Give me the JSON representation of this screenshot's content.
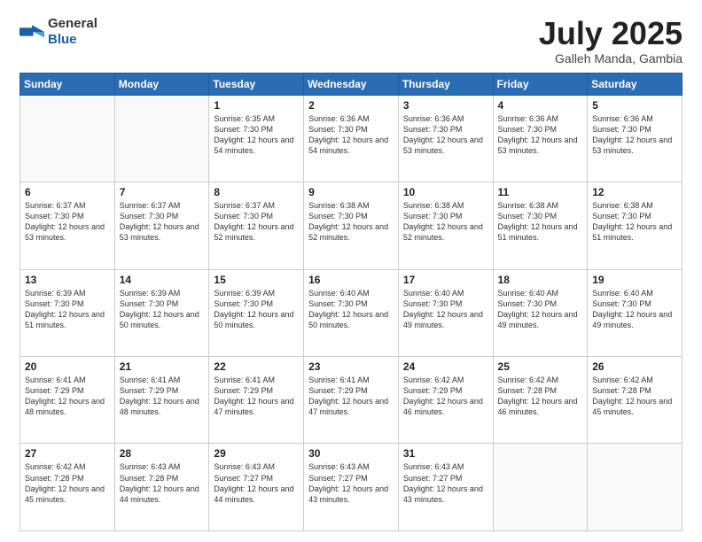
{
  "logo": {
    "text_general": "General",
    "text_blue": "Blue"
  },
  "title": {
    "month_year": "July 2025",
    "location": "Galleh Manda, Gambia"
  },
  "weekdays": [
    "Sunday",
    "Monday",
    "Tuesday",
    "Wednesday",
    "Thursday",
    "Friday",
    "Saturday"
  ],
  "weeks": [
    [
      {
        "day": "",
        "info": ""
      },
      {
        "day": "",
        "info": ""
      },
      {
        "day": "1",
        "info": "Sunrise: 6:35 AM\nSunset: 7:30 PM\nDaylight: 12 hours and 54 minutes."
      },
      {
        "day": "2",
        "info": "Sunrise: 6:36 AM\nSunset: 7:30 PM\nDaylight: 12 hours and 54 minutes."
      },
      {
        "day": "3",
        "info": "Sunrise: 6:36 AM\nSunset: 7:30 PM\nDaylight: 12 hours and 53 minutes."
      },
      {
        "day": "4",
        "info": "Sunrise: 6:36 AM\nSunset: 7:30 PM\nDaylight: 12 hours and 53 minutes."
      },
      {
        "day": "5",
        "info": "Sunrise: 6:36 AM\nSunset: 7:30 PM\nDaylight: 12 hours and 53 minutes."
      }
    ],
    [
      {
        "day": "6",
        "info": "Sunrise: 6:37 AM\nSunset: 7:30 PM\nDaylight: 12 hours and 53 minutes."
      },
      {
        "day": "7",
        "info": "Sunrise: 6:37 AM\nSunset: 7:30 PM\nDaylight: 12 hours and 53 minutes."
      },
      {
        "day": "8",
        "info": "Sunrise: 6:37 AM\nSunset: 7:30 PM\nDaylight: 12 hours and 52 minutes."
      },
      {
        "day": "9",
        "info": "Sunrise: 6:38 AM\nSunset: 7:30 PM\nDaylight: 12 hours and 52 minutes."
      },
      {
        "day": "10",
        "info": "Sunrise: 6:38 AM\nSunset: 7:30 PM\nDaylight: 12 hours and 52 minutes."
      },
      {
        "day": "11",
        "info": "Sunrise: 6:38 AM\nSunset: 7:30 PM\nDaylight: 12 hours and 51 minutes."
      },
      {
        "day": "12",
        "info": "Sunrise: 6:38 AM\nSunset: 7:30 PM\nDaylight: 12 hours and 51 minutes."
      }
    ],
    [
      {
        "day": "13",
        "info": "Sunrise: 6:39 AM\nSunset: 7:30 PM\nDaylight: 12 hours and 51 minutes."
      },
      {
        "day": "14",
        "info": "Sunrise: 6:39 AM\nSunset: 7:30 PM\nDaylight: 12 hours and 50 minutes."
      },
      {
        "day": "15",
        "info": "Sunrise: 6:39 AM\nSunset: 7:30 PM\nDaylight: 12 hours and 50 minutes."
      },
      {
        "day": "16",
        "info": "Sunrise: 6:40 AM\nSunset: 7:30 PM\nDaylight: 12 hours and 50 minutes."
      },
      {
        "day": "17",
        "info": "Sunrise: 6:40 AM\nSunset: 7:30 PM\nDaylight: 12 hours and 49 minutes."
      },
      {
        "day": "18",
        "info": "Sunrise: 6:40 AM\nSunset: 7:30 PM\nDaylight: 12 hours and 49 minutes."
      },
      {
        "day": "19",
        "info": "Sunrise: 6:40 AM\nSunset: 7:30 PM\nDaylight: 12 hours and 49 minutes."
      }
    ],
    [
      {
        "day": "20",
        "info": "Sunrise: 6:41 AM\nSunset: 7:29 PM\nDaylight: 12 hours and 48 minutes."
      },
      {
        "day": "21",
        "info": "Sunrise: 6:41 AM\nSunset: 7:29 PM\nDaylight: 12 hours and 48 minutes."
      },
      {
        "day": "22",
        "info": "Sunrise: 6:41 AM\nSunset: 7:29 PM\nDaylight: 12 hours and 47 minutes."
      },
      {
        "day": "23",
        "info": "Sunrise: 6:41 AM\nSunset: 7:29 PM\nDaylight: 12 hours and 47 minutes."
      },
      {
        "day": "24",
        "info": "Sunrise: 6:42 AM\nSunset: 7:29 PM\nDaylight: 12 hours and 46 minutes."
      },
      {
        "day": "25",
        "info": "Sunrise: 6:42 AM\nSunset: 7:28 PM\nDaylight: 12 hours and 46 minutes."
      },
      {
        "day": "26",
        "info": "Sunrise: 6:42 AM\nSunset: 7:28 PM\nDaylight: 12 hours and 45 minutes."
      }
    ],
    [
      {
        "day": "27",
        "info": "Sunrise: 6:42 AM\nSunset: 7:28 PM\nDaylight: 12 hours and 45 minutes."
      },
      {
        "day": "28",
        "info": "Sunrise: 6:43 AM\nSunset: 7:28 PM\nDaylight: 12 hours and 44 minutes."
      },
      {
        "day": "29",
        "info": "Sunrise: 6:43 AM\nSunset: 7:27 PM\nDaylight: 12 hours and 44 minutes."
      },
      {
        "day": "30",
        "info": "Sunrise: 6:43 AM\nSunset: 7:27 PM\nDaylight: 12 hours and 43 minutes."
      },
      {
        "day": "31",
        "info": "Sunrise: 6:43 AM\nSunset: 7:27 PM\nDaylight: 12 hours and 43 minutes."
      },
      {
        "day": "",
        "info": ""
      },
      {
        "day": "",
        "info": ""
      }
    ]
  ]
}
